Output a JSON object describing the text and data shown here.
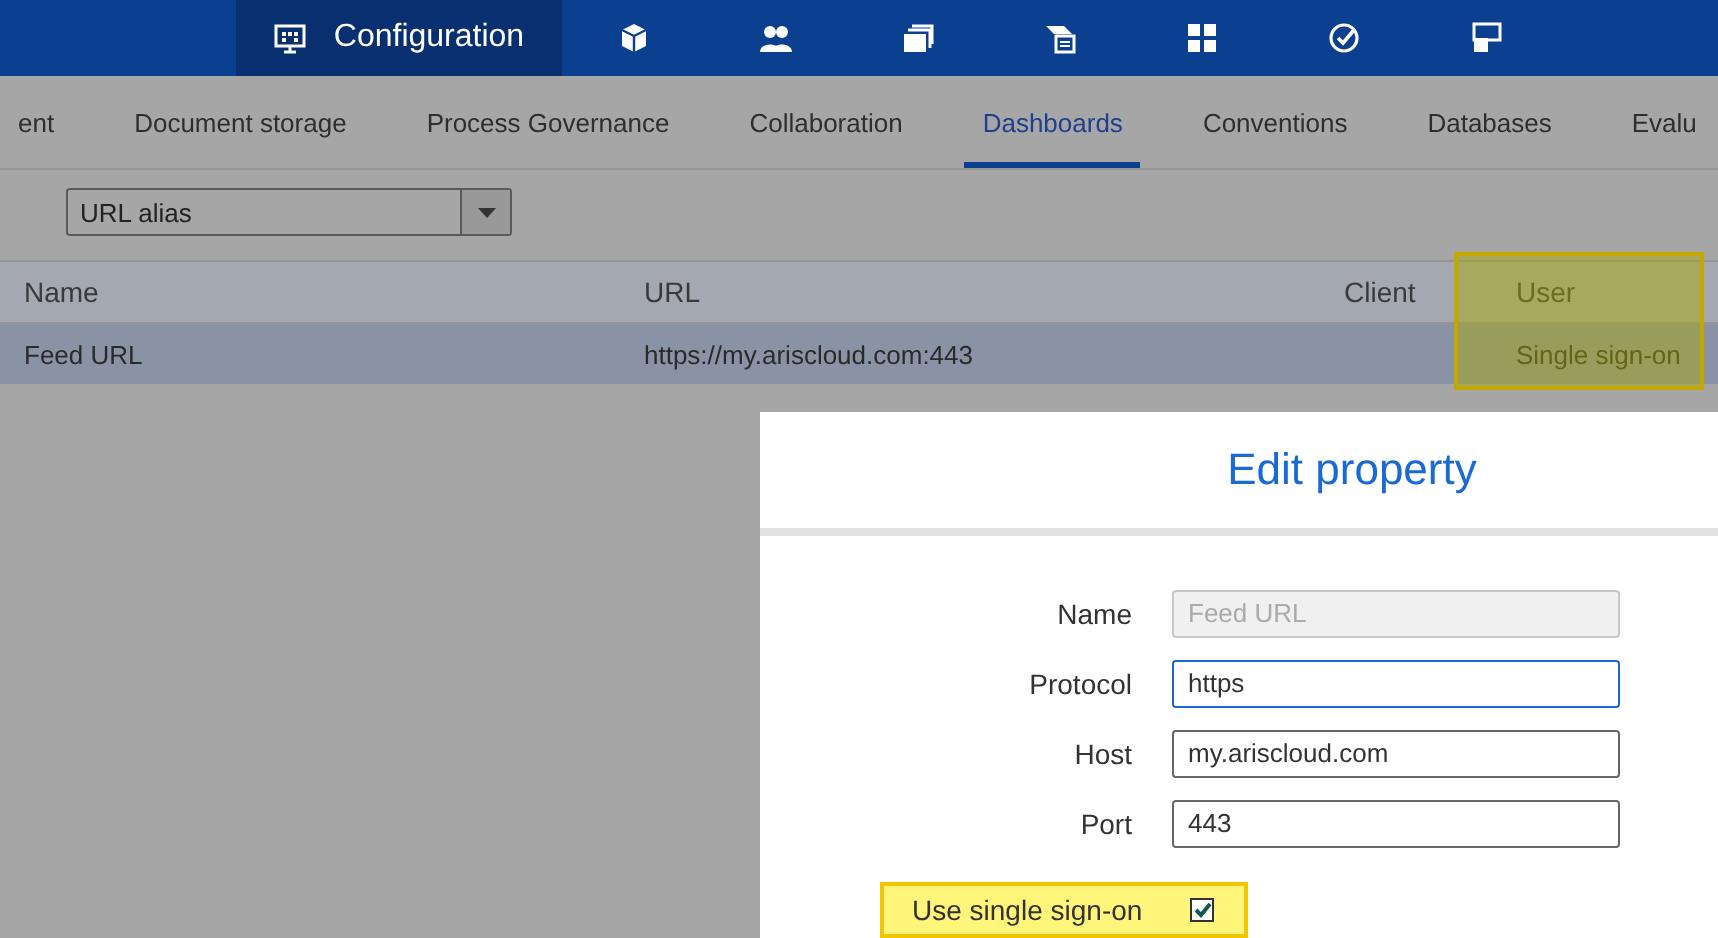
{
  "top_bar": {
    "items": [
      {
        "kind": "monitor",
        "label": "Configuration",
        "selected": true
      },
      {
        "kind": "box",
        "selected": false
      },
      {
        "kind": "people",
        "selected": false
      },
      {
        "kind": "stack",
        "selected": false
      },
      {
        "kind": "presenter",
        "selected": false
      },
      {
        "kind": "grid",
        "selected": false
      },
      {
        "kind": "check",
        "selected": false
      },
      {
        "kind": "squares",
        "selected": false
      }
    ]
  },
  "tabs": [
    {
      "label": "ent",
      "selected": false
    },
    {
      "label": "Document storage",
      "selected": false
    },
    {
      "label": "Process Governance",
      "selected": false
    },
    {
      "label": "Collaboration",
      "selected": false
    },
    {
      "label": "Dashboards",
      "selected": true
    },
    {
      "label": "Conventions",
      "selected": false
    },
    {
      "label": "Databases",
      "selected": false
    },
    {
      "label": "Evalu",
      "selected": false
    }
  ],
  "filter": {
    "value": "URL alias"
  },
  "table": {
    "columns": [
      {
        "label": "Name",
        "highlighted": false
      },
      {
        "label": "URL",
        "highlighted": false
      },
      {
        "label": "Client",
        "highlighted": false
      },
      {
        "label": "User",
        "highlighted": true
      }
    ],
    "rows": [
      {
        "selected": true,
        "cells": [
          "Feed URL",
          "https://my.ariscloud.com:443",
          "",
          "Single sign-on"
        ]
      }
    ]
  },
  "dialog": {
    "title": "Edit property",
    "fields": [
      {
        "label": "Name",
        "value": "Feed URL",
        "disabled": true,
        "focused": false
      },
      {
        "label": "Protocol",
        "value": "https",
        "disabled": false,
        "focused": true
      },
      {
        "label": "Host",
        "value": "my.ariscloud.com",
        "disabled": false,
        "focused": false
      },
      {
        "label": "Port",
        "value": "443",
        "disabled": false,
        "focused": false
      }
    ],
    "checkbox": {
      "label": "Use single sign-on",
      "checked": true,
      "highlighted": true
    }
  }
}
